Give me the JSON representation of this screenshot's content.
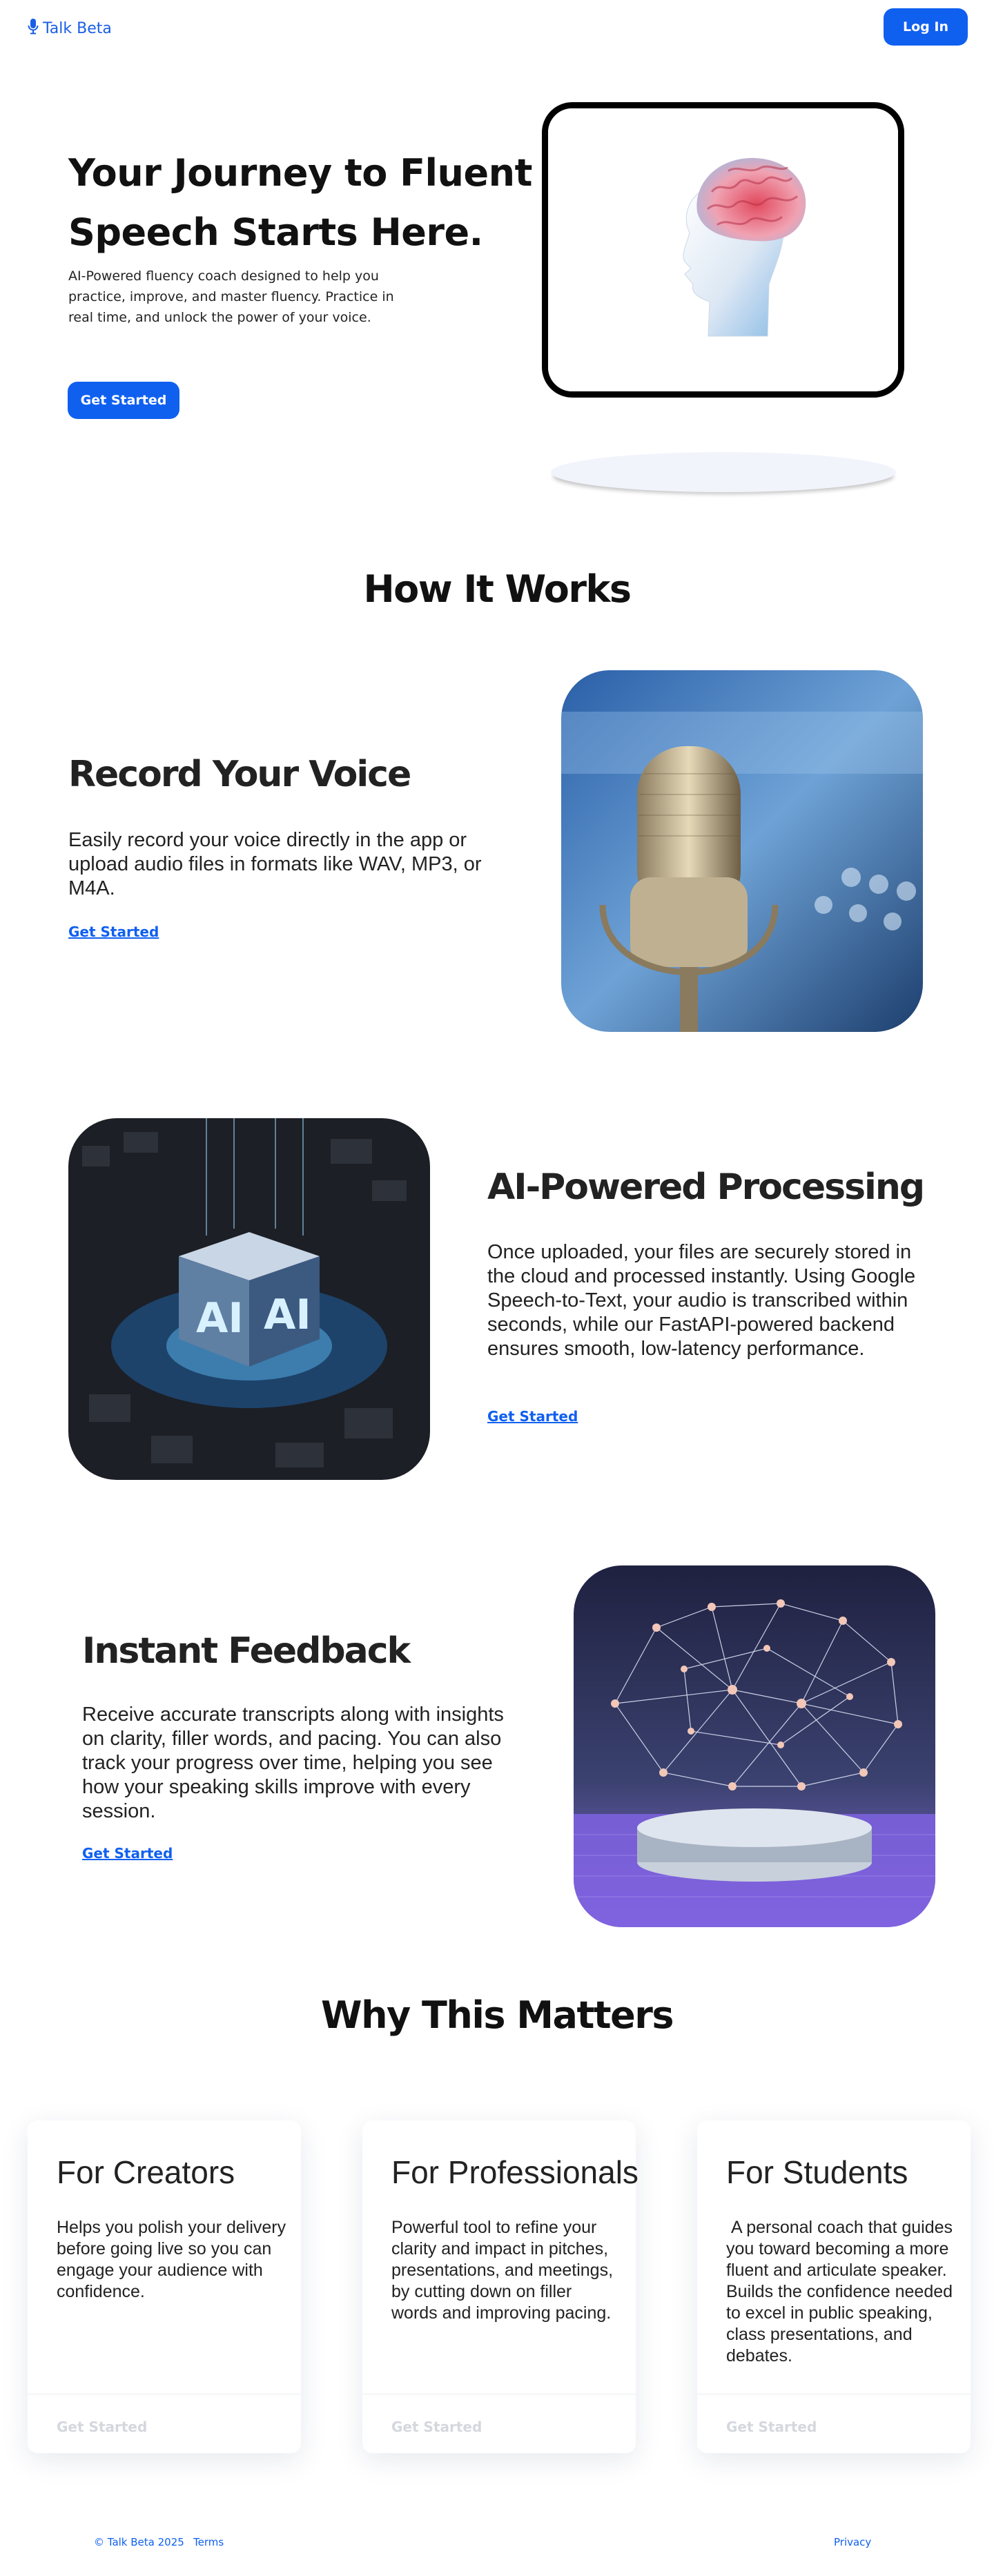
{
  "nav": {
    "brand": "Talk Beta",
    "login_label": "Log In",
    "icons": {
      "brand": "microphone-icon"
    }
  },
  "hero": {
    "title": "Your Journey to Fluent Speech Starts Here.",
    "subtitle": "AI-Powered fluency coach designed to help you practice, improve, and master fluency. Practice in real time, and unlock the power of your voice.",
    "cta_label": "Get Started"
  },
  "how_it_works": {
    "title": "How It Works",
    "features": [
      {
        "title": "Record Your Voice",
        "text": "Easily record your voice directly in the app or upload audio files in formats like WAV, MP3, or M4A.",
        "link": "Get Started"
      },
      {
        "title": "AI-Powered Processing",
        "text": "Once uploaded, your files are securely stored in the cloud and processed instantly. Using Google Speech-to-Text, your audio is transcribed within seconds, while our FastAPI-powered backend ensures smooth, low-latency performance.",
        "link": "Get Started"
      },
      {
        "title": "Instant Feedback",
        "text": "Receive accurate transcripts along with insights on clarity, filler words, and pacing. You can also track your progress over time, helping you see how your speaking skills improve with every session.",
        "link": "Get Started"
      }
    ]
  },
  "why": {
    "title": "Why This Matters",
    "cards": [
      {
        "title": "For Creators",
        "text": "Helps you polish your delivery before going live so you can engage your audience with confidence.",
        "button": "Get Started"
      },
      {
        "title": "For Professionals",
        "text": "Powerful tool to refine your clarity and impact in pitches, presentations, and meetings, by cutting down on filler words and improving pacing.",
        "button": "Get Started"
      },
      {
        "title": "For Students",
        "text": " A personal coach that guides you toward becoming a more fluent and articulate speaker. Builds the confidence needed to excel in public speaking, class presentations, and debates.",
        "button": "Get Started"
      }
    ]
  },
  "footer": {
    "copyright": "© Talk Beta 2025",
    "terms": "Terms",
    "privacy": "Privacy"
  },
  "colors": {
    "accent": "#1060f0",
    "text": "#222222",
    "disabled": "#d4d7dd"
  }
}
